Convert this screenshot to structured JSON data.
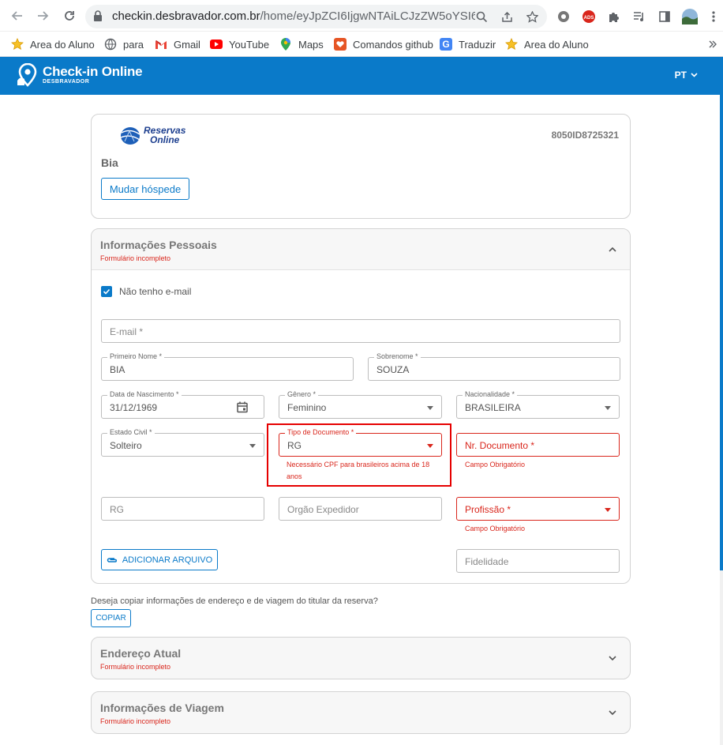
{
  "browser": {
    "url_host": "checkin.desbravador.com.br",
    "url_path": "/home/eyJpZCI6IjgwNTAiLCJzZW5oYSI6IkV..."
  },
  "bookmarks": [
    {
      "label": "Area do Aluno",
      "icon": "star-icon"
    },
    {
      "label": "para",
      "icon": "globe-icon"
    },
    {
      "label": "Gmail",
      "icon": "gmail-icon"
    },
    {
      "label": "YouTube",
      "icon": "youtube-icon"
    },
    {
      "label": "Maps",
      "icon": "maps-icon"
    },
    {
      "label": "Comandos github",
      "icon": "github-bookmark-icon"
    },
    {
      "label": "Traduzir",
      "icon": "translate-icon"
    },
    {
      "label": "Area do Aluno",
      "icon": "star-icon"
    }
  ],
  "appbar": {
    "title": "Check-in Online",
    "subtitle": "DESBRAVADOR",
    "lang": "PT"
  },
  "reservation": {
    "logo_line1": "Reservas",
    "logo_line2": "Online",
    "booking_id": "8050ID8725321",
    "guest_name": "Bia",
    "change_guest_label": "Mudar hóspede"
  },
  "personal": {
    "title": "Informações Pessoais",
    "status": "Formulário incompleto",
    "no_email_label": "Não tenho e-mail",
    "no_email_checked": true,
    "email_placeholder": "E-mail *",
    "first_name_label": "Primeiro Nome *",
    "first_name": "BIA",
    "last_name_label": "Sobrenome *",
    "last_name": "SOUZA",
    "birth_label": "Data de Nascimento *",
    "birth": "31/12/1969",
    "gender_label": "Gênero *",
    "gender": "Feminino",
    "nationality_label": "Nacionalidade *",
    "nationality": "BRASILEIRA",
    "civil_label": "Estado Civil *",
    "civil": "Solteiro",
    "doc_type_label": "Tipo de Documento *",
    "doc_type": "RG",
    "doc_type_error": "Necessário CPF para brasileiros acima de 18 anos",
    "doc_number_placeholder": "Nr. Documento *",
    "doc_number_error": "Campo Obrigatório",
    "rg_placeholder": "RG",
    "issuer_placeholder": "Orgão Expedidor",
    "profession_placeholder": "Profissão *",
    "profession_error": "Campo Obrigatório",
    "attach_label": "ADICIONAR ARQUIVO",
    "loyalty_placeholder": "Fidelidade"
  },
  "copy": {
    "question": "Deseja copiar informações de endereço e de viagem do titular da reserva?",
    "button": "COPIAR"
  },
  "address": {
    "title": "Endereço Atual",
    "status": "Formulário incompleto"
  },
  "travel": {
    "title": "Informações de Viagem",
    "status": "Formulário incompleto"
  },
  "colors": {
    "brand": "#0a7ac9",
    "error": "#d9261c",
    "highlight": "#e60000"
  }
}
